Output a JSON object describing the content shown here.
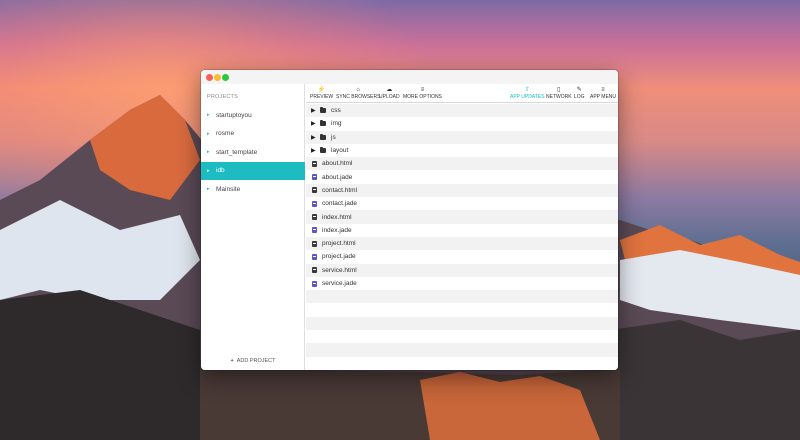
{
  "sidebar": {
    "header": "PROJECTS",
    "projects": [
      {
        "label": "startuptoyou",
        "active": false
      },
      {
        "label": "rosme",
        "active": false
      },
      {
        "label": "start_template",
        "active": false
      },
      {
        "label": "idb",
        "active": true
      },
      {
        "label": "Mainsite",
        "active": false
      }
    ],
    "add_project": "ADD PROJECT",
    "add_icon": "plus-icon"
  },
  "toolbar": {
    "left": [
      {
        "label": "PREVIEW",
        "icon": "lightning-icon",
        "glyph": "⚡"
      },
      {
        "label": "SYNC BROWSERS",
        "icon": "home-icon",
        "glyph": "⌂"
      },
      {
        "label": "UPLOAD",
        "icon": "cloud-upload-icon",
        "glyph": "☁"
      },
      {
        "label": "MORE OPTIONS",
        "icon": "menu-icon",
        "glyph": "≡"
      }
    ],
    "right": [
      {
        "label": "APP UPDATES",
        "icon": "update-icon",
        "glyph": "⇧",
        "accent": true
      },
      {
        "label": "NETWORK",
        "icon": "mobile-icon",
        "glyph": "▯"
      },
      {
        "label": "LOG",
        "icon": "pencil-icon",
        "glyph": "✎"
      },
      {
        "label": "APP MENU",
        "icon": "menu-icon",
        "glyph": "≡"
      }
    ]
  },
  "files": [
    {
      "name": "css",
      "type": "folder"
    },
    {
      "name": "img",
      "type": "folder"
    },
    {
      "name": "js",
      "type": "folder"
    },
    {
      "name": "layout",
      "type": "folder"
    },
    {
      "name": "about.html",
      "type": "html"
    },
    {
      "name": "about.jade",
      "type": "jade"
    },
    {
      "name": "contact.html",
      "type": "html"
    },
    {
      "name": "contact.jade",
      "type": "jade"
    },
    {
      "name": "index.html",
      "type": "html"
    },
    {
      "name": "index.jade",
      "type": "jade"
    },
    {
      "name": "project.html",
      "type": "html"
    },
    {
      "name": "project.jade",
      "type": "jade"
    },
    {
      "name": "service.html",
      "type": "html"
    },
    {
      "name": "service.jade",
      "type": "jade"
    }
  ],
  "empty_rows": 6,
  "colors": {
    "accent": "#1cbcc0",
    "close": "#fc5f57",
    "minimize": "#fdbc2e",
    "maximize": "#29c840"
  }
}
